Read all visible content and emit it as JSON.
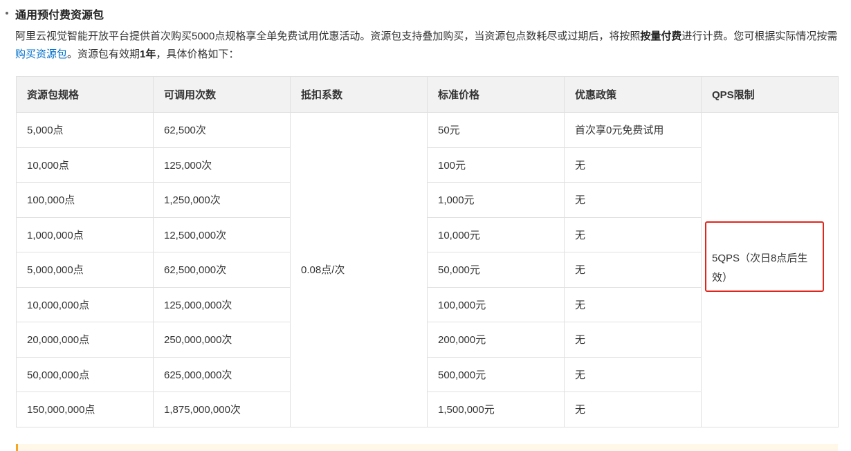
{
  "section": {
    "heading": "通用预付费资源包",
    "intro_part1": "阿里云视觉智能开放平台提供首次购买5000点规格享全单免费试用优惠活动。资源包支持叠加购买，当资源包点数耗尽或过期后，将按照",
    "intro_bold1": "按量付费",
    "intro_part2": "进行计费。您可根据实际情况按需",
    "intro_link": "购买资源包",
    "intro_part3": "。资源包有效期",
    "intro_bold2": "1年",
    "intro_part4": "，具体价格如下："
  },
  "table": {
    "headers": [
      "资源包规格",
      "可调用次数",
      "抵扣系数",
      "标准价格",
      "优惠政策",
      "QPS限制"
    ],
    "deduction": "0.08点/次",
    "qps": "5QPS（次日8点后生效）",
    "rows": [
      {
        "spec": "5,000点",
        "calls": "62,500次",
        "price": "50元",
        "discount": "首次享0元免费试用"
      },
      {
        "spec": "10,000点",
        "calls": "125,000次",
        "price": "100元",
        "discount": "无"
      },
      {
        "spec": "100,000点",
        "calls": "1,250,000次",
        "price": "1,000元",
        "discount": "无"
      },
      {
        "spec": "1,000,000点",
        "calls": "12,500,000次",
        "price": "10,000元",
        "discount": "无"
      },
      {
        "spec": "5,000,000点",
        "calls": "62,500,000次",
        "price": "50,000元",
        "discount": "无"
      },
      {
        "spec": "10,000,000点",
        "calls": "125,000,000次",
        "price": "100,000元",
        "discount": "无"
      },
      {
        "spec": "20,000,000点",
        "calls": "250,000,000次",
        "price": "200,000元",
        "discount": "无"
      },
      {
        "spec": "50,000,000点",
        "calls": "625,000,000次",
        "price": "500,000元",
        "discount": "无"
      },
      {
        "spec": "150,000,000点",
        "calls": "1,875,000,000次",
        "price": "1,500,000元",
        "discount": "无"
      }
    ]
  },
  "colors": {
    "highlight_border": "#e1251b",
    "link": "#0070cc",
    "header_bg": "#f2f2f2",
    "note_accent": "#f5a623"
  }
}
